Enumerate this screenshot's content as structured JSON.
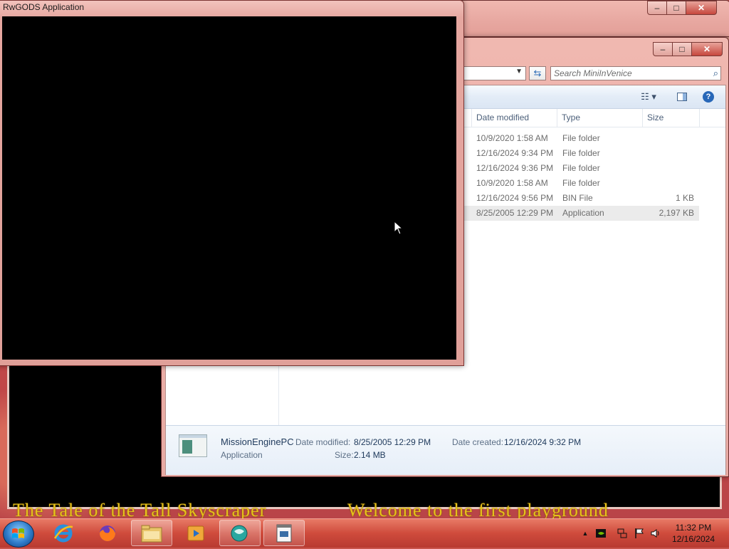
{
  "desktop": {
    "banner_left": "The Tale of the Tall Skyscraper",
    "banner_right": "Welcome to the first playground"
  },
  "background_window": {
    "minimize": "–",
    "maximize": "□",
    "close": "✕"
  },
  "explorer": {
    "caption": {
      "minimize": "–",
      "maximize": "□",
      "close": "✕"
    },
    "address": {
      "dropdown": "▼"
    },
    "refresh_glyph": "⇆",
    "search": {
      "placeholder": "Search MiniInVenice"
    },
    "toolbar": {
      "views_glyph": "☷ ▾",
      "help_glyph": "?"
    },
    "columns": {
      "date_modified": "Date modified",
      "type": "Type",
      "size": "Size"
    },
    "rows": [
      {
        "date": "10/9/2020 1:58 AM",
        "type": "File folder",
        "size": ""
      },
      {
        "date": "12/16/2024 9:34 PM",
        "type": "File folder",
        "size": ""
      },
      {
        "date": "12/16/2024 9:36 PM",
        "type": "File folder",
        "size": ""
      },
      {
        "date": "10/9/2020 1:58 AM",
        "type": "File folder",
        "size": ""
      },
      {
        "date": "12/16/2024 9:56 PM",
        "type": "BIN File",
        "size": "1 KB"
      },
      {
        "date": "8/25/2005 12:29 PM",
        "type": "Application",
        "size": "2,197 KB"
      }
    ],
    "details": {
      "name": "MissionEnginePC",
      "kind": "Application",
      "modified_label": "Date modified:",
      "modified_value": "8/25/2005 12:29 PM",
      "size_label": "Size:",
      "size_value": "2.14 MB",
      "created_label": "Date created:",
      "created_value": "12/16/2024 9:32 PM"
    }
  },
  "rwgods": {
    "title": "RwGODS Application"
  },
  "taskbar": {
    "apps": [
      {
        "name": "internet-explorer",
        "open": false
      },
      {
        "name": "firefox",
        "open": false
      },
      {
        "name": "file-explorer",
        "open": true
      },
      {
        "name": "media-player",
        "open": false
      },
      {
        "name": "game-app",
        "open": true
      },
      {
        "name": "rwgods-app",
        "open": true
      }
    ],
    "tray": {
      "show_hidden": "▲"
    },
    "clock": {
      "time": "11:32 PM",
      "date": "12/16/2024"
    }
  },
  "colors": {
    "window_frame": "#e6a7a0",
    "taskbar": "#cf4b3c",
    "banner_text": "#e6c21a",
    "column_header_text": "#4c607a"
  }
}
